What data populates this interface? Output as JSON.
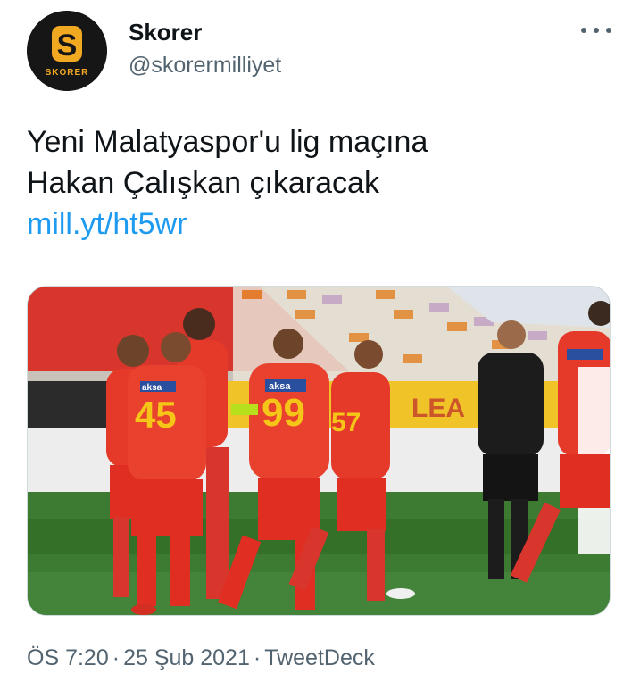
{
  "author": {
    "display_name": "Skorer",
    "handle": "@skorermilliyet",
    "avatar_letter": "S",
    "avatar_wordmark": "SKORER"
  },
  "tweet": {
    "text_lines": [
      "Yeni Malatyaspor'u lig maçına",
      "Hakan Çalışkan çıkaracak"
    ],
    "link": "mill.yt/ht5wr"
  },
  "media": {
    "alt_icon": "photo-football-players-celebrating",
    "jersey_numbers": [
      "45",
      "99",
      "57"
    ],
    "sponsor_text": "aksa"
  },
  "meta": {
    "time": "ÖS 7:20",
    "separator": "·",
    "date": "25 Şub 2021",
    "source": "TweetDeck"
  },
  "colors": {
    "link": "#1d9bf0",
    "secondary_text": "#536471",
    "jersey_red": "#e53a2a",
    "jersey_yellow": "#f5c518"
  }
}
